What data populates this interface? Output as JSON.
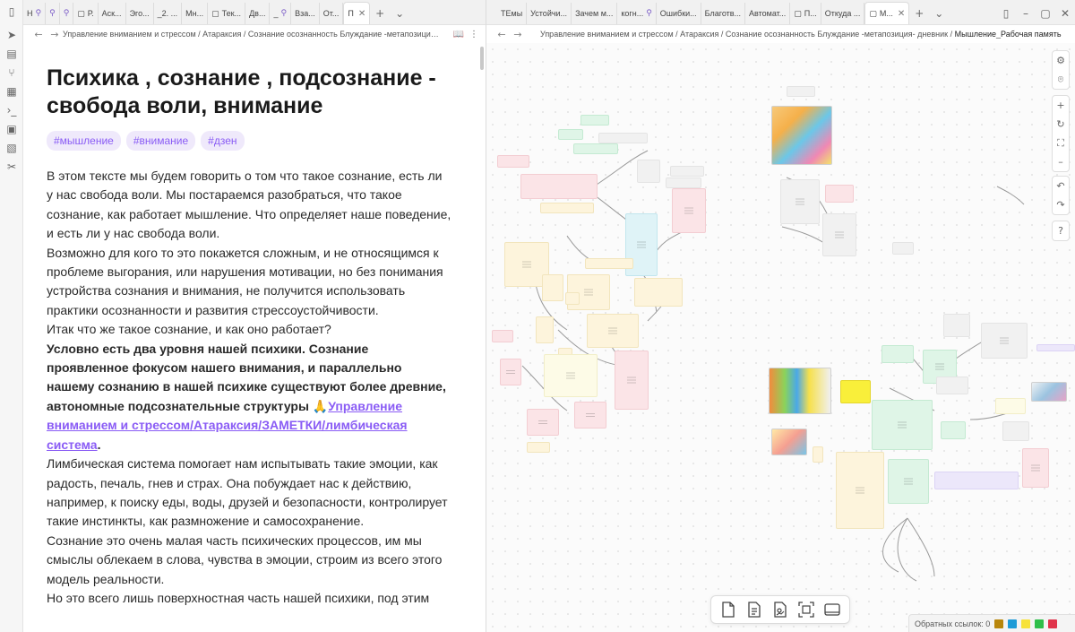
{
  "left_tabs": [
    {
      "label": "Н",
      "pinned": true
    },
    {
      "label": "",
      "pinned": true
    },
    {
      "label": "",
      "pinned": true
    },
    {
      "label": "Р.",
      "pinned": false
    },
    {
      "label": "Аск...",
      "pinned": false
    },
    {
      "label": "Эго...",
      "pinned": false
    },
    {
      "label": "_2. ...",
      "pinned": false
    },
    {
      "label": "Мн...",
      "pinned": false
    },
    {
      "label": "Тек...",
      "pinned": false
    },
    {
      "label": "Дв...",
      "pinned": false
    },
    {
      "label": "_",
      "pinned": true
    },
    {
      "label": "Вза...",
      "pinned": false
    },
    {
      "label": "От...",
      "pinned": false
    },
    {
      "label": "П",
      "pinned": false,
      "active": true
    }
  ],
  "right_tabs": [
    {
      "label": "ТЕмы",
      "pinned": false
    },
    {
      "label": "Устойчи...",
      "pinned": false
    },
    {
      "label": "Зачем м...",
      "pinned": false
    },
    {
      "label": "когн...",
      "pinned": true
    },
    {
      "label": "Ошибки...",
      "pinned": false
    },
    {
      "label": "Благотв...",
      "pinned": false
    },
    {
      "label": "Автомат...",
      "pinned": false
    },
    {
      "label": "П...",
      "pinned": false
    },
    {
      "label": "Откуда ...",
      "pinned": false
    },
    {
      "label": "М...",
      "pinned": false,
      "active": true
    }
  ],
  "left_breadcrumb": "Управление вниманием и стрессом / Атараксия / Сознание осознанность Блуждание -метапозиция- дне",
  "right_breadcrumb": "Управление вниманием и стрессом / Атараксия / Сознание осознанность Блуждание -метапозиция- дневник / ",
  "right_breadcrumb_current": "Мышление_Рабочая память",
  "note": {
    "title": "Психика , сознание , подсознание - свобода воли, внимание",
    "tags": [
      "#мышление",
      "#внимание",
      "#дзен"
    ],
    "p1": "В этом тексте мы будем говорить о том что такое сознание, есть ли у нас свобода воли. Мы постараемся разобраться, что такое сознание, как работает мышление. Что определяет наше поведение, и есть ли  у нас свобода воли.",
    "p2": "Возможно для кого то это покажется сложным, и не относящимся к проблеме выгорания, или нарушения мотивации, но без понимания устройства сознания и внимания, не получится использовать практики осознанности и развития стрессоустойчивости.",
    "p3": "Итак что же такое сознание, и как оно работает?",
    "p4_bold": "Условно есть два уровня нашей психики. Сознание проявленное фокусом нашего внимания, и параллельно нашему сознанию в нашей психике существуют более древние, автономные подсознательные структуры 🙏",
    "p4_link": "Управление вниманием и стрессом/Атараксия/ЗАМЕТКИ/лимбическая система",
    "p4_dot": ".",
    "p5": "Лимбическая система помогает нам испытывать такие эмоции, как радость, печаль, гнев и страх. Она побуждает нас к действию, например, к поиску еды, воды, друзей и безопасности, контролирует такие инстинкты, как размножение и самосохранение.",
    "p6": "Сознание это очень малая часть психических процессов, им мы смыслы облекаем в слова, чувства в эмоции, строим из всего этого модель реальности.",
    "p7": "Но это всего лишь поверхностная часть нашей психики, под этим"
  },
  "status": {
    "backlinks": "Обратных ссылок: 0",
    "colors": [
      "#b8860b",
      "#1e9bd7",
      "#f7e23a",
      "#2fbf4a",
      "#e0344b"
    ]
  },
  "accent": "#8a5cf5"
}
